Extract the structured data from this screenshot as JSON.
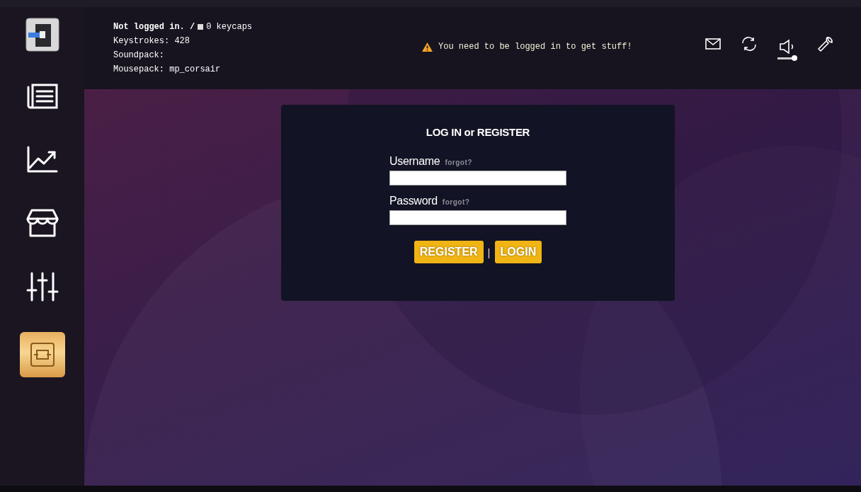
{
  "status": {
    "login": "Not logged in. /",
    "keycaps": "0 keycaps",
    "lines": [
      "Keystrokes: 428",
      "Soundpack:",
      "Mousepack: mp_corsair"
    ]
  },
  "notice": "You need to be logged in to get stuff!",
  "volume": {
    "level": 0.85
  },
  "login": {
    "title": "LOG IN or REGISTER",
    "fields": [
      {
        "label": "Username",
        "link": "forgot?"
      },
      {
        "label": "Password",
        "link": "forgot?"
      }
    ],
    "buttons": [
      "REGISTER",
      "LOGIN"
    ],
    "separator": "|"
  }
}
